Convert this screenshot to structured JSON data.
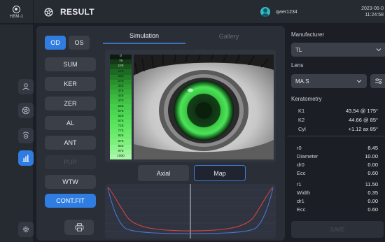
{
  "app": {
    "logo_icon": "eye-logo-icon",
    "model": "HBM-1"
  },
  "header": {
    "title": "RESULT",
    "title_icon": "aperture-icon"
  },
  "user": {
    "name": "qwer1234",
    "avatar_icon": "user-avatar-icon"
  },
  "datetime": {
    "date": "2023-06-0",
    "time": "11:24:58"
  },
  "sidebar": {
    "items": [
      {
        "name": "user",
        "icon": "person-icon"
      },
      {
        "name": "topography",
        "icon": "aperture-icon"
      },
      {
        "name": "eye-scan",
        "icon": "eye-scan-icon"
      },
      {
        "name": "analysis",
        "icon": "bar-chart-icon",
        "active": true
      },
      {
        "name": "settings",
        "icon": "gear-icon"
      }
    ]
  },
  "eye_toggle": {
    "od": "OD",
    "os": "OS",
    "selected": "OD"
  },
  "modes": [
    {
      "label": "SUM",
      "state": "normal"
    },
    {
      "label": "KER",
      "state": "normal"
    },
    {
      "label": "ZER",
      "state": "normal"
    },
    {
      "label": "AL",
      "state": "normal"
    },
    {
      "label": "ANT",
      "state": "normal"
    },
    {
      "label": "PUP",
      "state": "disabled"
    },
    {
      "label": "WTW",
      "state": "normal"
    },
    {
      "label": "CONT.FIT",
      "state": "active"
    }
  ],
  "print": {
    "icon": "printer-icon"
  },
  "tabs": {
    "simulation": "Simulation",
    "gallery": "Gallery",
    "selected": "Simulation"
  },
  "fluor_scale": [
    "0",
    "75",
    "125",
    "175",
    "225",
    "275",
    "325",
    "375",
    "425",
    "475",
    "525",
    "575",
    "625",
    "675",
    "725",
    "775",
    "825",
    "875",
    "925",
    "975",
    "1000"
  ],
  "view": {
    "axial": "Axial",
    "map": "Map",
    "selected": "Map"
  },
  "right": {
    "manufacturer_label": "Manufacturer",
    "manufacturer_value": "TL",
    "lens_label": "Lens",
    "lens_value": "MA.S",
    "keratometry_label": "Keratometry",
    "keratometry": [
      {
        "key": "K1",
        "value": "43.54 @ 175°"
      },
      {
        "key": "K2",
        "value": "44.66 @ 85°"
      },
      {
        "key": "Cyl",
        "value": "+1.12 ax 85°"
      }
    ],
    "params_a": [
      {
        "key": "r0",
        "value": "8.45"
      },
      {
        "key": "Diameter",
        "value": "10.00"
      },
      {
        "key": "dr0",
        "value": "0.00"
      },
      {
        "key": "Ecc",
        "value": "0.60"
      }
    ],
    "params_b": [
      {
        "key": "r1",
        "value": "11.50"
      },
      {
        "key": "Width",
        "value": "0.35"
      },
      {
        "key": "dr1",
        "value": "0.00"
      },
      {
        "key": "Ecc",
        "value": "0.60"
      }
    ],
    "save_label": "SAVE"
  },
  "colors": {
    "accent": "#2f7de1",
    "panel": "#2a2e36",
    "fluor_green": "#37d447"
  }
}
